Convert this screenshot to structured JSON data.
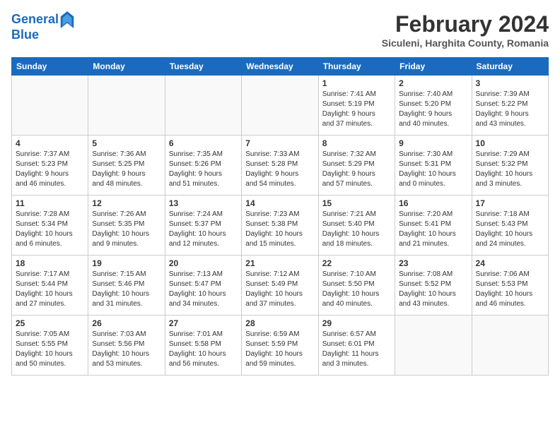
{
  "header": {
    "logo_line1": "General",
    "logo_line2": "Blue",
    "month": "February 2024",
    "location": "Siculeni, Harghita County, Romania"
  },
  "weekdays": [
    "Sunday",
    "Monday",
    "Tuesday",
    "Wednesday",
    "Thursday",
    "Friday",
    "Saturday"
  ],
  "weeks": [
    [
      {
        "day": "",
        "info": ""
      },
      {
        "day": "",
        "info": ""
      },
      {
        "day": "",
        "info": ""
      },
      {
        "day": "",
        "info": ""
      },
      {
        "day": "1",
        "info": "Sunrise: 7:41 AM\nSunset: 5:19 PM\nDaylight: 9 hours\nand 37 minutes."
      },
      {
        "day": "2",
        "info": "Sunrise: 7:40 AM\nSunset: 5:20 PM\nDaylight: 9 hours\nand 40 minutes."
      },
      {
        "day": "3",
        "info": "Sunrise: 7:39 AM\nSunset: 5:22 PM\nDaylight: 9 hours\nand 43 minutes."
      }
    ],
    [
      {
        "day": "4",
        "info": "Sunrise: 7:37 AM\nSunset: 5:23 PM\nDaylight: 9 hours\nand 46 minutes."
      },
      {
        "day": "5",
        "info": "Sunrise: 7:36 AM\nSunset: 5:25 PM\nDaylight: 9 hours\nand 48 minutes."
      },
      {
        "day": "6",
        "info": "Sunrise: 7:35 AM\nSunset: 5:26 PM\nDaylight: 9 hours\nand 51 minutes."
      },
      {
        "day": "7",
        "info": "Sunrise: 7:33 AM\nSunset: 5:28 PM\nDaylight: 9 hours\nand 54 minutes."
      },
      {
        "day": "8",
        "info": "Sunrise: 7:32 AM\nSunset: 5:29 PM\nDaylight: 9 hours\nand 57 minutes."
      },
      {
        "day": "9",
        "info": "Sunrise: 7:30 AM\nSunset: 5:31 PM\nDaylight: 10 hours\nand 0 minutes."
      },
      {
        "day": "10",
        "info": "Sunrise: 7:29 AM\nSunset: 5:32 PM\nDaylight: 10 hours\nand 3 minutes."
      }
    ],
    [
      {
        "day": "11",
        "info": "Sunrise: 7:28 AM\nSunset: 5:34 PM\nDaylight: 10 hours\nand 6 minutes."
      },
      {
        "day": "12",
        "info": "Sunrise: 7:26 AM\nSunset: 5:35 PM\nDaylight: 10 hours\nand 9 minutes."
      },
      {
        "day": "13",
        "info": "Sunrise: 7:24 AM\nSunset: 5:37 PM\nDaylight: 10 hours\nand 12 minutes."
      },
      {
        "day": "14",
        "info": "Sunrise: 7:23 AM\nSunset: 5:38 PM\nDaylight: 10 hours\nand 15 minutes."
      },
      {
        "day": "15",
        "info": "Sunrise: 7:21 AM\nSunset: 5:40 PM\nDaylight: 10 hours\nand 18 minutes."
      },
      {
        "day": "16",
        "info": "Sunrise: 7:20 AM\nSunset: 5:41 PM\nDaylight: 10 hours\nand 21 minutes."
      },
      {
        "day": "17",
        "info": "Sunrise: 7:18 AM\nSunset: 5:43 PM\nDaylight: 10 hours\nand 24 minutes."
      }
    ],
    [
      {
        "day": "18",
        "info": "Sunrise: 7:17 AM\nSunset: 5:44 PM\nDaylight: 10 hours\nand 27 minutes."
      },
      {
        "day": "19",
        "info": "Sunrise: 7:15 AM\nSunset: 5:46 PM\nDaylight: 10 hours\nand 31 minutes."
      },
      {
        "day": "20",
        "info": "Sunrise: 7:13 AM\nSunset: 5:47 PM\nDaylight: 10 hours\nand 34 minutes."
      },
      {
        "day": "21",
        "info": "Sunrise: 7:12 AM\nSunset: 5:49 PM\nDaylight: 10 hours\nand 37 minutes."
      },
      {
        "day": "22",
        "info": "Sunrise: 7:10 AM\nSunset: 5:50 PM\nDaylight: 10 hours\nand 40 minutes."
      },
      {
        "day": "23",
        "info": "Sunrise: 7:08 AM\nSunset: 5:52 PM\nDaylight: 10 hours\nand 43 minutes."
      },
      {
        "day": "24",
        "info": "Sunrise: 7:06 AM\nSunset: 5:53 PM\nDaylight: 10 hours\nand 46 minutes."
      }
    ],
    [
      {
        "day": "25",
        "info": "Sunrise: 7:05 AM\nSunset: 5:55 PM\nDaylight: 10 hours\nand 50 minutes."
      },
      {
        "day": "26",
        "info": "Sunrise: 7:03 AM\nSunset: 5:56 PM\nDaylight: 10 hours\nand 53 minutes."
      },
      {
        "day": "27",
        "info": "Sunrise: 7:01 AM\nSunset: 5:58 PM\nDaylight: 10 hours\nand 56 minutes."
      },
      {
        "day": "28",
        "info": "Sunrise: 6:59 AM\nSunset: 5:59 PM\nDaylight: 10 hours\nand 59 minutes."
      },
      {
        "day": "29",
        "info": "Sunrise: 6:57 AM\nSunset: 6:01 PM\nDaylight: 11 hours\nand 3 minutes."
      },
      {
        "day": "",
        "info": ""
      },
      {
        "day": "",
        "info": ""
      }
    ]
  ]
}
